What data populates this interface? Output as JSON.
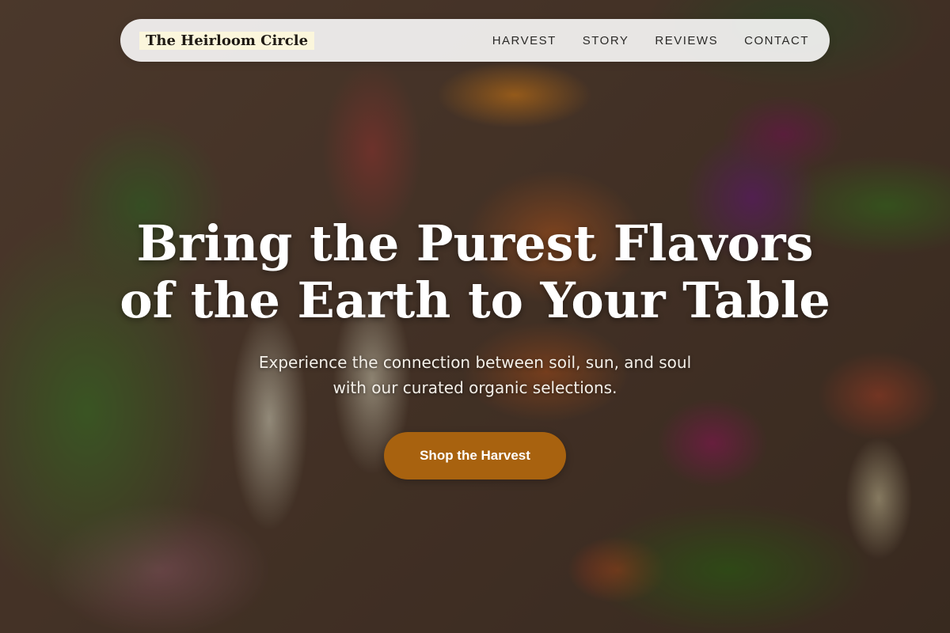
{
  "brand": {
    "name": "The Heirloom Circle"
  },
  "nav": {
    "items": [
      {
        "label": "HARVEST"
      },
      {
        "label": "STORY"
      },
      {
        "label": "REVIEWS"
      },
      {
        "label": "CONTACT"
      }
    ]
  },
  "hero": {
    "headline_line1": "Bring the Purest Flavors",
    "headline_line2": "of the Earth to Your Table",
    "subtitle_line1": "Experience the connection between soil, sun, and soul",
    "subtitle_line2": "with our curated organic selections.",
    "cta_label": "Shop the Harvest"
  },
  "colors": {
    "cta": "#a8620f",
    "nav_bg": "#ffffff",
    "logo_highlight": "#fbf6dc"
  }
}
